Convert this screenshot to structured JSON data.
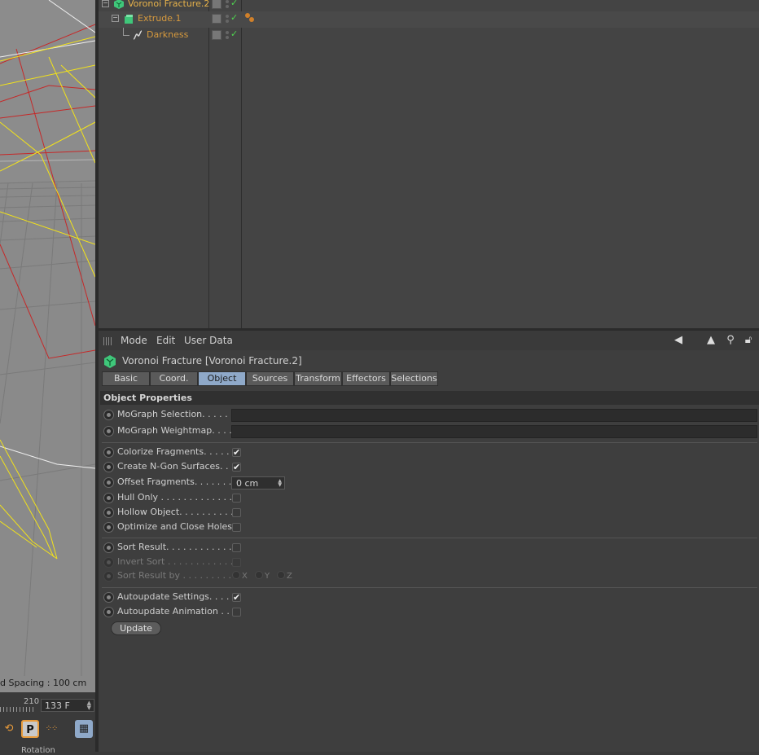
{
  "viewport": {
    "grid_spacing_label": "d Spacing : 100 cm"
  },
  "timeline": {
    "frame_marker": "210",
    "frame_field": "133 F",
    "rotation_label": "Rotation"
  },
  "object_manager": {
    "objects": [
      {
        "name": "Voronoi Fracture.2",
        "icon": "voronoi-fracture-icon"
      },
      {
        "name": "Extrude.1",
        "icon": "extrude-icon"
      },
      {
        "name": "Darkness",
        "icon": "spline-icon"
      }
    ]
  },
  "attribute_manager": {
    "menu": [
      "Mode",
      "Edit",
      "User Data"
    ],
    "title": "Voronoi Fracture [Voronoi Fracture.2]",
    "tabs": [
      "Basic",
      "Coord.",
      "Object",
      "Sources",
      "Transform",
      "Effectors",
      "Selections"
    ],
    "active_tab": "Object",
    "section_title": "Object Properties",
    "props": {
      "mograph_selection": "MoGraph Selection. . . . . .",
      "mograph_weightmap": "MoGraph Weightmap. . . .",
      "colorize_fragments": "Colorize Fragments. . . . . .",
      "create_ngon": "Create N-Gon Surfaces. . .",
      "offset_fragments": "Offset Fragments. . . . . . . .",
      "offset_value": "0 cm",
      "hull_only": "Hull Only . . . . . . . . . . . . . .",
      "hollow_object": "Hollow Object. . . . . . . . . . .",
      "optimize_close_holes": "Optimize and Close Holes",
      "sort_result": "Sort Result. . . . . . . . . . . . .",
      "invert_sort": "Invert Sort . . . . . . . . . . . . .",
      "sort_result_by": "Sort Result by . . . . . . . . . .",
      "axis_x": "X",
      "axis_y": "Y",
      "axis_z": "Z",
      "autoupdate_settings": "Autoupdate Settings. . . . .",
      "autoupdate_animation": "Autoupdate Animation . . .",
      "update_button": "Update"
    },
    "check_mark": "✔"
  },
  "colors": {
    "object_name": "#d79a3e",
    "active_tab": "#8fa9c9",
    "enabled_check": "#4fd34f"
  }
}
